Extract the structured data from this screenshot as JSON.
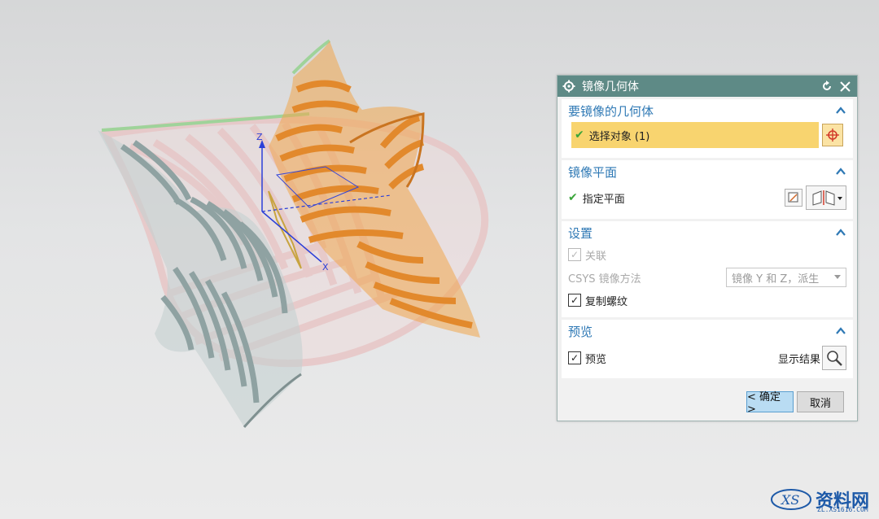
{
  "dialog": {
    "title": "镜像几何体",
    "sections": {
      "geometry": {
        "title": "要镜像的几何体",
        "select_label": "选择对象 (1)"
      },
      "plane": {
        "title": "镜像平面",
        "specify_label": "指定平面"
      },
      "settings": {
        "title": "设置",
        "associate_label": "关联",
        "csys_label": "CSYS 镜像方法",
        "csys_value": "镜像 Y 和 Z，派生",
        "copy_threads_label": "复制螺纹"
      },
      "preview": {
        "title": "预览",
        "preview_label": "预览",
        "show_result_label": "显示结果"
      }
    },
    "buttons": {
      "ok": "< 确定 >",
      "cancel": "取消"
    }
  },
  "axes": {
    "z": "Z",
    "x": "X"
  },
  "watermark": {
    "text": "资料网",
    "url": "ZL.XS1616.COM"
  },
  "colors": {
    "title_bar": "#5e8a86",
    "section_title": "#2f79b5",
    "selection_highlight": "#f8d46f",
    "shape_orange": "#e8943a",
    "shape_gray": "#a9b8b8",
    "shape_pink": "#e6c2c2"
  }
}
